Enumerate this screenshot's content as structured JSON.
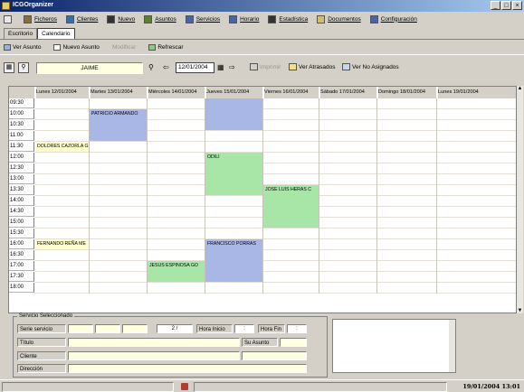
{
  "window": {
    "title": "ICGOrganizer",
    "buttons": [
      "_",
      "□",
      "×"
    ]
  },
  "menu": [
    {
      "label": "Ficheros",
      "icon": "folder-icon",
      "color": "#8a6d3b"
    },
    {
      "label": "Clientes",
      "icon": "people-icon",
      "color": "#3a6ea5"
    },
    {
      "label": "Nuevo",
      "icon": "phone-icon",
      "color": "#333333"
    },
    {
      "label": "Asuntos",
      "icon": "pen-icon",
      "color": "#5a7f3a"
    },
    {
      "label": "Servicios",
      "icon": "list-icon",
      "color": "#4b64a0"
    },
    {
      "label": "Horario",
      "icon": "calendar-icon",
      "color": "#4b64a0"
    },
    {
      "label": "Estadística",
      "icon": "sigma-icon",
      "color": "#333333"
    },
    {
      "label": "Documentos",
      "icon": "document-icon",
      "color": "#cfc06b"
    },
    {
      "label": "Configuración",
      "icon": "settings-icon",
      "color": "#4b64a0"
    }
  ],
  "tabs": [
    {
      "label": "Escritorio",
      "active": false
    },
    {
      "label": "Calendario",
      "active": true
    }
  ],
  "toolbar": [
    {
      "label": "Ver Asunto",
      "enabled": true
    },
    {
      "label": "Nuevo Asunto",
      "enabled": true
    },
    {
      "label": "Modificar",
      "enabled": false
    },
    {
      "label": "Refrescar",
      "enabled": true
    }
  ],
  "filter": {
    "user": "JAIME",
    "date": "12/01/2004",
    "prev_icon": "arrow-left-icon",
    "next_icon": "arrow-right-icon",
    "imprimir": "Imprimir",
    "ver_atrasados": "Ver Atrasados",
    "ver_no_asignados": "Ver No Asignados"
  },
  "calendar": {
    "days": [
      "Lunes 12/01/2004",
      "Martes 13/01/2004",
      "Miércoles 14/01/2004",
      "Jueves 15/01/2004",
      "Viernes 16/01/2004",
      "Sábado 17/01/2004",
      "Domingo 18/01/2004",
      "Lunes 19/01/2004"
    ],
    "times": [
      "09:30",
      "10:00",
      "10:30",
      "11:00",
      "11:30",
      "12:00",
      "12:30",
      "13:00",
      "13:30",
      "14:00",
      "14:30",
      "15:00",
      "15:30",
      "16:00",
      "16:30",
      "17:00",
      "17:30",
      "18:00"
    ],
    "events": [
      {
        "day": 1,
        "start": "10:00",
        "end": "11:30",
        "label": "PATRICIO ARMANDO",
        "color": "blue"
      },
      {
        "day": 0,
        "start": "11:30",
        "end": "12:00",
        "label": "DOLORES CAZORLA G",
        "color": "yellow"
      },
      {
        "day": 3,
        "start": "09:30",
        "end": "11:00",
        "label": "",
        "color": "blue"
      },
      {
        "day": 3,
        "start": "12:00",
        "end": "14:00",
        "label": "ODILI",
        "color": "green"
      },
      {
        "day": 4,
        "start": "13:30",
        "end": "15:30",
        "label": "JOSE LUIS HERAS C",
        "color": "green"
      },
      {
        "day": 0,
        "start": "16:00",
        "end": "16:30",
        "label": "FERNANDO REÑA ME",
        "color": "yellow"
      },
      {
        "day": 3,
        "start": "16:00",
        "end": "18:00",
        "label": "FRANCISCO PORRAS",
        "color": "blue"
      },
      {
        "day": 2,
        "start": "17:00",
        "end": "18:00",
        "label": "JESUS ESPINOSA GO",
        "color": "green"
      }
    ]
  },
  "details": {
    "legend": "Servicio Seleccionado",
    "serie_label": "Serie servicio",
    "date_value": "2 /",
    "hora_inicio_label": "Hora Inicio",
    "hora_inicio_value": ":",
    "hora_fin_label": "Hora Fin",
    "hora_fin_value": ":",
    "titulo_label": "Título",
    "su_asunto_label": "Su Asunto",
    "cliente_label": "Cliente",
    "direccion_label": "Dirección"
  },
  "status": {
    "datetime": "19/01/2004 13:01"
  }
}
